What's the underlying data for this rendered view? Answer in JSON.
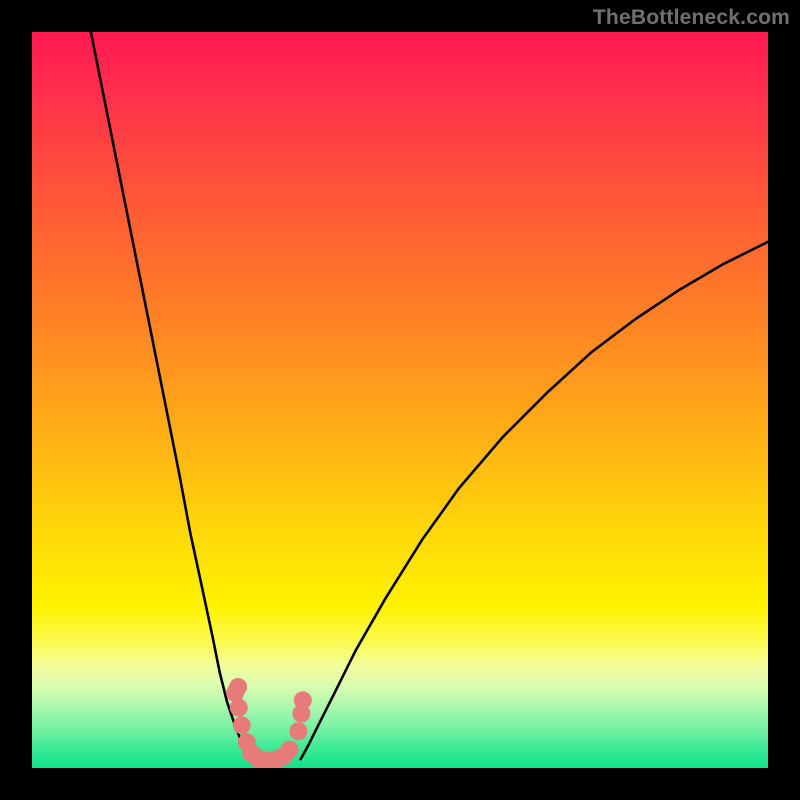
{
  "watermark": "TheBottleneck.com",
  "chart_data": {
    "type": "line",
    "title": "",
    "xlabel": "",
    "ylabel": "",
    "xlim": [
      0,
      100
    ],
    "ylim": [
      0,
      100
    ],
    "background_gradient": {
      "orientation": "vertical",
      "stops": [
        {
          "pos": 0,
          "color": "#ff1a53"
        },
        {
          "pos": 30,
          "color": "#ff6a2f"
        },
        {
          "pos": 55,
          "color": "#ffb016"
        },
        {
          "pos": 78,
          "color": "#fff200"
        },
        {
          "pos": 100,
          "color": "#14e28c"
        }
      ]
    },
    "series": [
      {
        "name": "curve-left",
        "stroke": "#000000",
        "x": [
          8,
          10,
          12,
          14,
          16,
          18,
          20,
          21.5,
          23,
          24.5,
          25.5,
          26.5,
          27.5,
          28.3,
          29,
          29.5
        ],
        "y": [
          100,
          90,
          80,
          70,
          60,
          50,
          40,
          32,
          25,
          18,
          13,
          9,
          6,
          4,
          2.2,
          1.2
        ]
      },
      {
        "name": "curve-right",
        "stroke": "#000000",
        "x": [
          36.5,
          37.5,
          39,
          41,
          44,
          48,
          53,
          58,
          64,
          70,
          76,
          82,
          88,
          94,
          100
        ],
        "y": [
          1.2,
          3,
          6,
          10,
          16,
          23,
          31,
          38,
          45,
          51,
          56.5,
          61,
          65,
          68.5,
          71.5
        ]
      },
      {
        "name": "marker-cluster",
        "type": "scatter",
        "color": "#e77b7a",
        "x": [
          27.6,
          28.1,
          28.5,
          29.2,
          30.5,
          32.0,
          33.5,
          35.0,
          36.2,
          36.8,
          29.8,
          31.0,
          32.5,
          34.2,
          28.0,
          36.6
        ],
        "y": [
          10.2,
          8.2,
          5.8,
          3.5,
          1.5,
          1.0,
          1.3,
          2.5,
          5.0,
          9.2,
          2.0,
          1.0,
          0.9,
          1.6,
          11.0,
          7.4
        ]
      }
    ]
  }
}
